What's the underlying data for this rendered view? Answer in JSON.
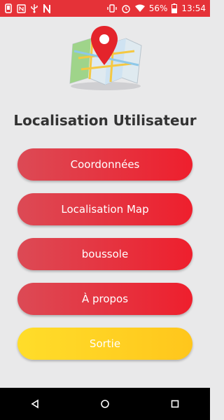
{
  "status_bar": {
    "battery": "56%",
    "time": "13:54",
    "left_icons": [
      "phone-icon",
      "nfc-icon",
      "usb-icon",
      "n-icon"
    ],
    "right_icons": [
      "vibrate-icon",
      "alarm-icon",
      "wifi-icon",
      "battery-icon"
    ]
  },
  "header": {
    "title": "Localisation Utilisateur",
    "hero_icon": "map-pin-icon"
  },
  "menu": {
    "coordonnees": "Coordonnées",
    "localisation_map": "Localisation Map",
    "boussole": "boussole",
    "a_propos": "À propos",
    "sortie": "Sortie"
  },
  "colors": {
    "status_bar": "#e53238",
    "button_red_start": "#dc4a55",
    "button_red_end": "#ee1f2d",
    "button_yellow_start": "#ffdd2a",
    "button_yellow_end": "#ffc61c",
    "background": "#e9e9ea",
    "title_text": "#333333"
  },
  "nav_bar": {
    "icons": [
      "back-icon",
      "home-icon",
      "recents-icon"
    ]
  }
}
